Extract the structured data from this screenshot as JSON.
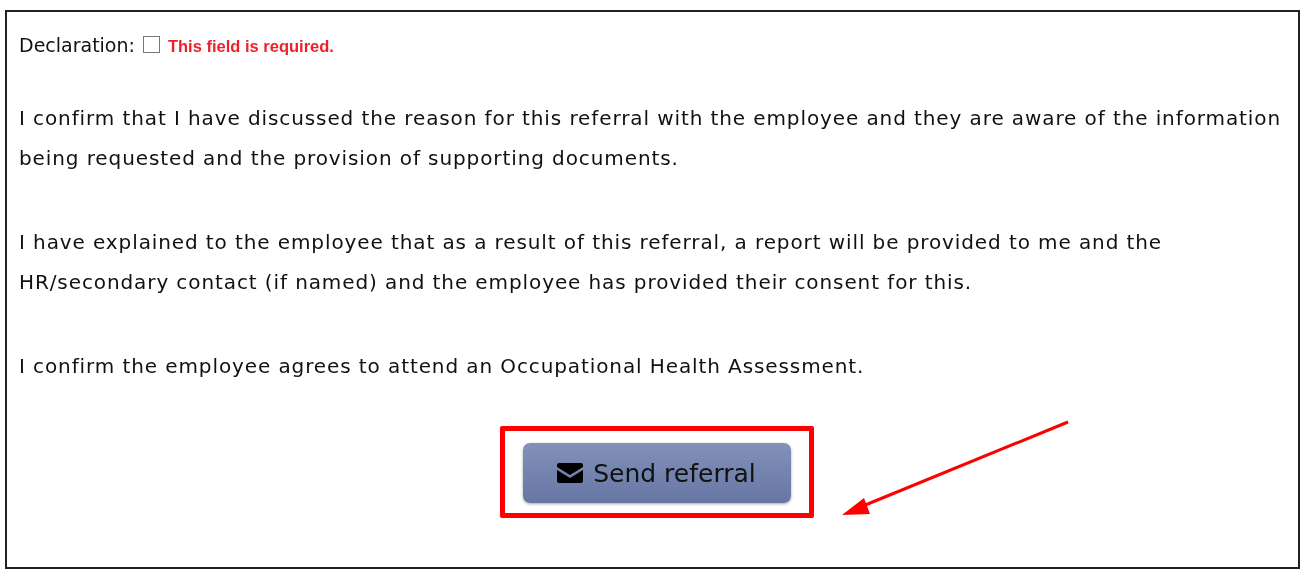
{
  "declaration": {
    "label": "Declaration:",
    "checked": false,
    "error": "This field is required."
  },
  "paragraphs": [
    "I confirm that I have discussed the reason for this referral with the employee and they are aware of the information being requested and the provision of supporting documents.",
    "I have explained to the employee that as a result of this referral, a report will be provided to me and the HR/secondary contact (if named) and the employee has provided their consent for this.",
    "I confirm the employee agrees to attend an Occupational Health Assessment."
  ],
  "submit_button": {
    "label": "Send referral"
  }
}
